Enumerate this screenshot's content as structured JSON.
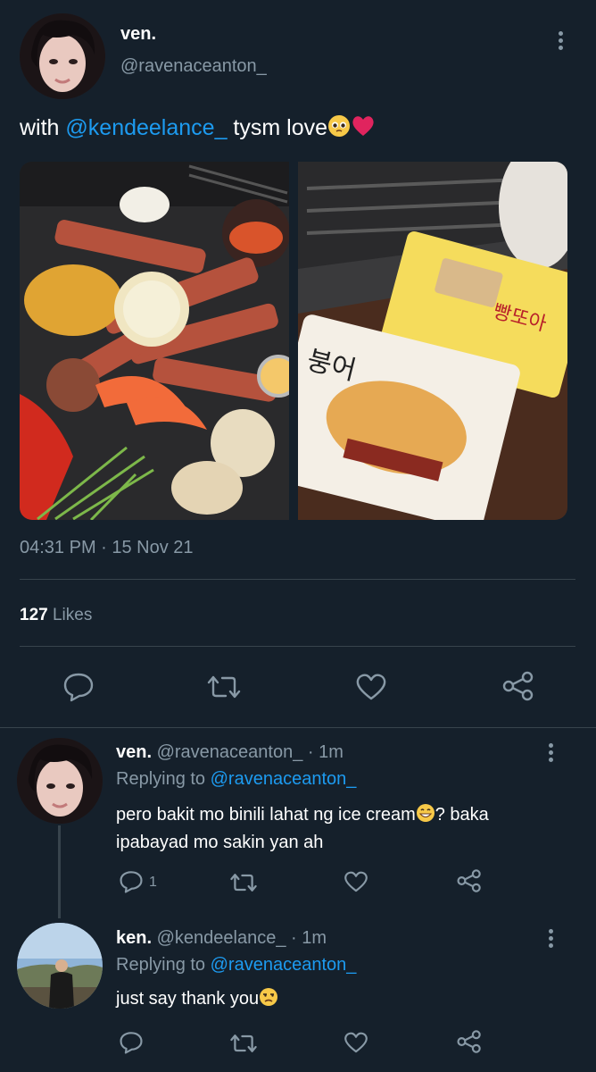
{
  "main_tweet": {
    "display_name": "ven.",
    "handle": "@ravenaceanton_",
    "text_prefix": "with ",
    "mention": "@kendeelance_",
    "text_suffix": " tysm love",
    "timestamp": "04:31 PM · 15 Nov 21",
    "likes_count": "127",
    "likes_label": "Likes",
    "images": [
      "korean-bbq-grill-photo",
      "fish-ice-cream-sandwich-photo"
    ]
  },
  "replies": [
    {
      "display_name": "ven.",
      "handle_time": "@ravenaceanton_ · 1m",
      "replying_prefix": "Replying to ",
      "replying_to": "@ravenaceanton_",
      "text_line1": "pero bakit mo binili lahat ng ice cream",
      "text_line1b": "? baka",
      "text_line2": "ipabayad mo sakin yan ah",
      "reply_count": "1"
    },
    {
      "display_name": "ken.",
      "handle_time": "@kendeelance_ · 1m",
      "replying_prefix": "Replying to ",
      "replying_to": "@ravenaceanton_",
      "text": "just say thank you",
      "reply_count": ""
    }
  ],
  "colors": {
    "background": "#15202b",
    "accent": "#1d9bf0",
    "muted": "#8899a6",
    "divider": "#38444d"
  },
  "icons": [
    "more-icon",
    "reply-icon",
    "retweet-icon",
    "like-icon",
    "share-icon"
  ]
}
